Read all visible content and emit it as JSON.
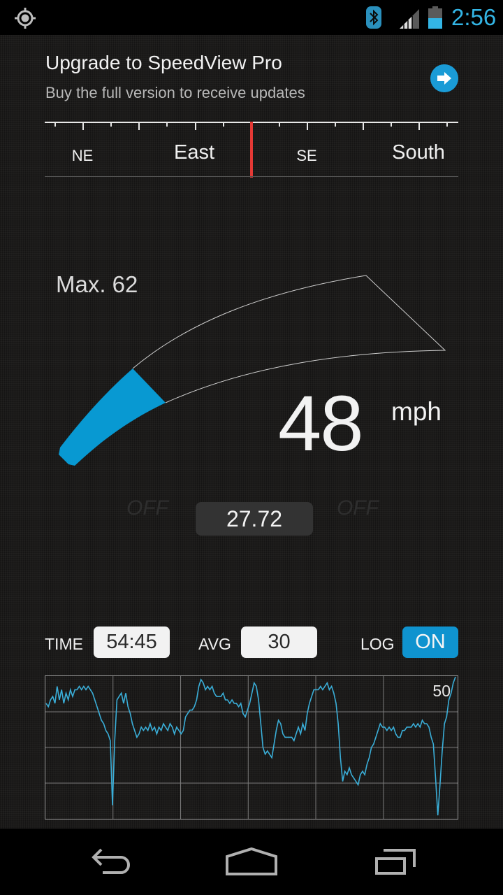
{
  "status_bar": {
    "time": "2:56",
    "icons": [
      "gps-icon",
      "bluetooth-icon",
      "signal-icon",
      "battery-icon"
    ],
    "accent": "#33b5e5"
  },
  "upgrade_banner": {
    "title": "Upgrade to SpeedView Pro",
    "subtitle": "Buy the full version to receive updates",
    "action_icon": "arrow-right-circle-icon",
    "accent": "#1a9bd6"
  },
  "compass": {
    "labels": [
      {
        "text": "NE",
        "size": "small"
      },
      {
        "text": "East",
        "size": "big"
      },
      {
        "text": "SE",
        "size": "small"
      },
      {
        "text": "South",
        "size": "big"
      }
    ],
    "needle_color": "#e53935"
  },
  "speedometer": {
    "max_label": "Max. 62",
    "speed": "48",
    "unit": "mph",
    "speed_value": 48,
    "max_value": 62,
    "gauge_fill_fraction": 0.16,
    "fill_color": "#0899d2"
  },
  "trip": {
    "distance": "27.72",
    "left_indicator": "OFF",
    "right_indicator": "OFF"
  },
  "controls": {
    "time_label": "TIME",
    "time_value": "54:45",
    "avg_label": "AVG",
    "avg_value": "30",
    "log_label": "LOG",
    "log_toggle": "ON",
    "toggle_color": "#0f93cf"
  },
  "speed_graph": {
    "scale_label": "50",
    "line_color": "#3aaed8",
    "y_max": 50,
    "y_min": 10,
    "values": [
      44,
      43,
      45,
      46,
      44,
      49,
      45,
      48,
      44,
      47,
      45,
      48,
      46,
      48,
      48,
      49,
      48,
      49,
      48,
      49,
      48,
      47,
      45,
      43,
      41,
      39,
      38,
      36,
      35,
      33,
      14,
      33,
      45,
      46,
      47,
      44,
      47,
      43,
      41,
      38,
      36,
      34,
      35,
      37,
      36,
      37,
      36,
      38,
      36,
      37,
      35,
      37,
      36,
      38,
      37,
      36,
      38,
      37,
      35,
      37,
      36,
      35,
      36,
      40,
      41,
      42,
      42,
      43,
      45,
      49,
      51,
      50,
      48,
      49,
      48,
      49,
      47,
      46,
      46,
      46,
      47,
      45,
      45,
      44,
      45,
      44,
      44,
      43,
      44,
      41,
      40,
      42,
      44,
      47,
      50,
      49,
      45,
      38,
      31,
      29,
      30,
      29,
      28,
      32,
      36,
      39,
      38,
      35,
      34,
      34,
      34,
      34,
      33,
      35,
      37,
      35,
      38,
      36,
      41,
      44,
      46,
      48,
      48,
      48,
      49,
      48,
      49,
      50,
      48,
      49,
      47,
      44,
      38,
      28,
      21,
      24,
      23,
      25,
      23,
      22,
      21,
      20,
      23,
      24,
      23,
      26,
      28,
      31,
      32,
      34,
      36,
      38,
      37,
      37,
      36,
      37,
      36,
      37,
      35,
      34,
      34,
      36,
      36,
      37,
      37,
      37,
      38,
      37,
      38,
      37,
      39,
      38,
      38,
      37,
      34,
      32,
      22,
      11,
      20,
      30,
      38,
      40,
      45,
      47,
      50,
      52
    ]
  },
  "nav_bar": {
    "buttons": [
      "back-icon",
      "home-icon",
      "recents-icon"
    ]
  }
}
